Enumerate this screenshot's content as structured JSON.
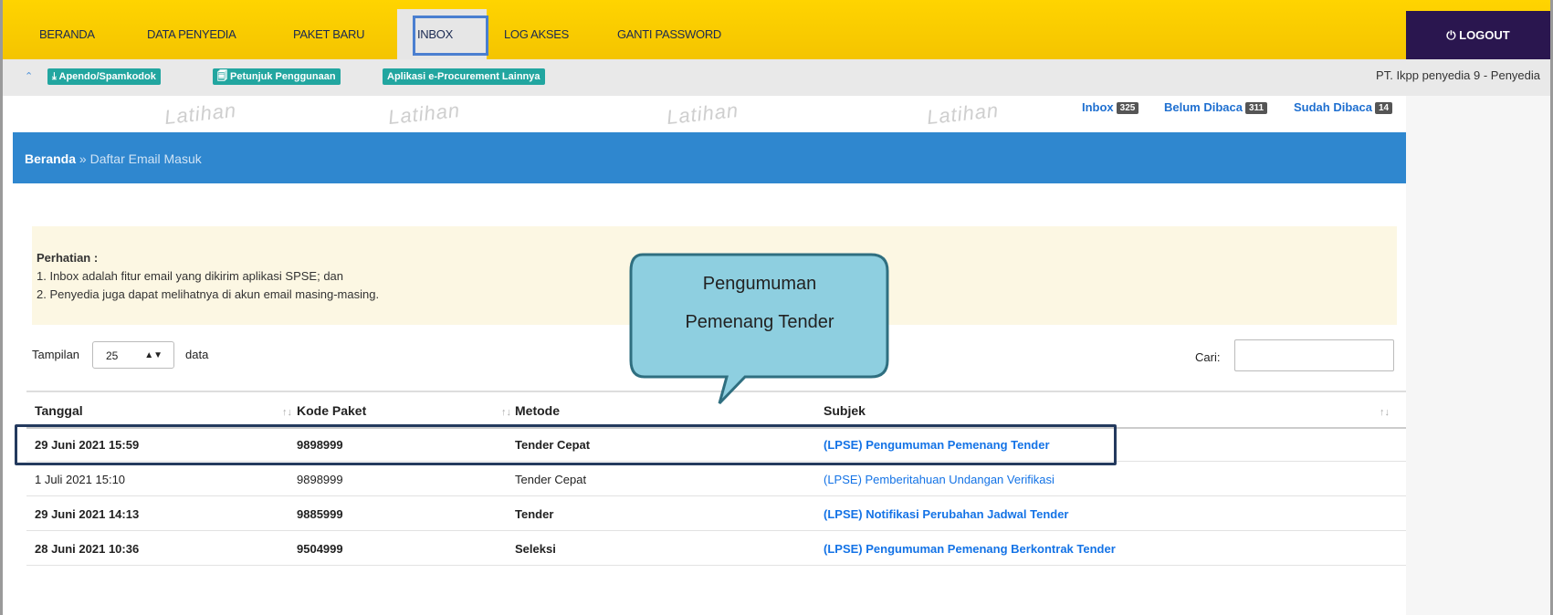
{
  "nav": {
    "items": [
      "BERANDA",
      "DATA PENYEDIA",
      "PAKET BARU",
      "INBOX",
      "LOG AKSES",
      "GANTI PASSWORD"
    ],
    "logout": "⏻ LOGOUT"
  },
  "subbar": {
    "chips": [
      "⤓ Apendo/Spamkodok",
      "🗐 Petunjuk Penggunaan",
      "Aplikasi e-Procurement Lainnya"
    ],
    "user": "PT. Ikpp penyedia 9 - Penyedia",
    "watermark": "Latihan"
  },
  "counters": {
    "inbox_label": "Inbox",
    "inbox_count": "325",
    "unread_label": "Belum Dibaca",
    "unread_count": "311",
    "read_label": "Sudah Dibaca",
    "read_count": "14"
  },
  "breadcrumb": {
    "home": "Beranda",
    "sep": " » ",
    "current": "Daftar Email Masuk"
  },
  "notice": {
    "title": "Perhatian :",
    "line1": "1. Inbox adalah fitur email yang dikirim aplikasi SPSE; dan",
    "line2": "2. Penyedia juga dapat melihatnya di akun email masing-masing."
  },
  "controls": {
    "show_label": "Tampilan",
    "page_size": "25",
    "data_label": "data",
    "search_label": "Cari:"
  },
  "table": {
    "headers": [
      "Tanggal",
      "Kode Paket",
      "Metode",
      "Subjek"
    ],
    "rows": [
      {
        "tanggal": "29 Juni 2021 15:59",
        "kode": "9898999",
        "metode": "Tender Cepat",
        "subjek": "(LPSE) Pengumuman Pemenang Tender",
        "bold": true
      },
      {
        "tanggal": "1 Juli 2021 15:10",
        "kode": "9898999",
        "metode": "Tender Cepat",
        "subjek": "(LPSE) Pemberitahuan Undangan Verifikasi",
        "bold": false
      },
      {
        "tanggal": "29 Juni 2021 14:13",
        "kode": "9885999",
        "metode": "Tender",
        "subjek": "(LPSE) Notifikasi Perubahan Jadwal Tender",
        "bold": true
      },
      {
        "tanggal": "28 Juni 2021 10:36",
        "kode": "9504999",
        "metode": "Seleksi",
        "subjek": "(LPSE) Pengumuman Pemenang Berkontrak Tender",
        "bold": true
      }
    ]
  },
  "callout": {
    "line1": "Pengumuman",
    "line2": "Pemenang Tender",
    "fill": "#8ecfe0",
    "stroke": "#2f6f80"
  },
  "colors": {
    "nav_yellow": "#ffd400",
    "logout_bg": "#2a164f",
    "breadcrumb_bg": "#2f87cf",
    "chip_teal": "#22a6a0",
    "link_blue": "#1473e6"
  }
}
